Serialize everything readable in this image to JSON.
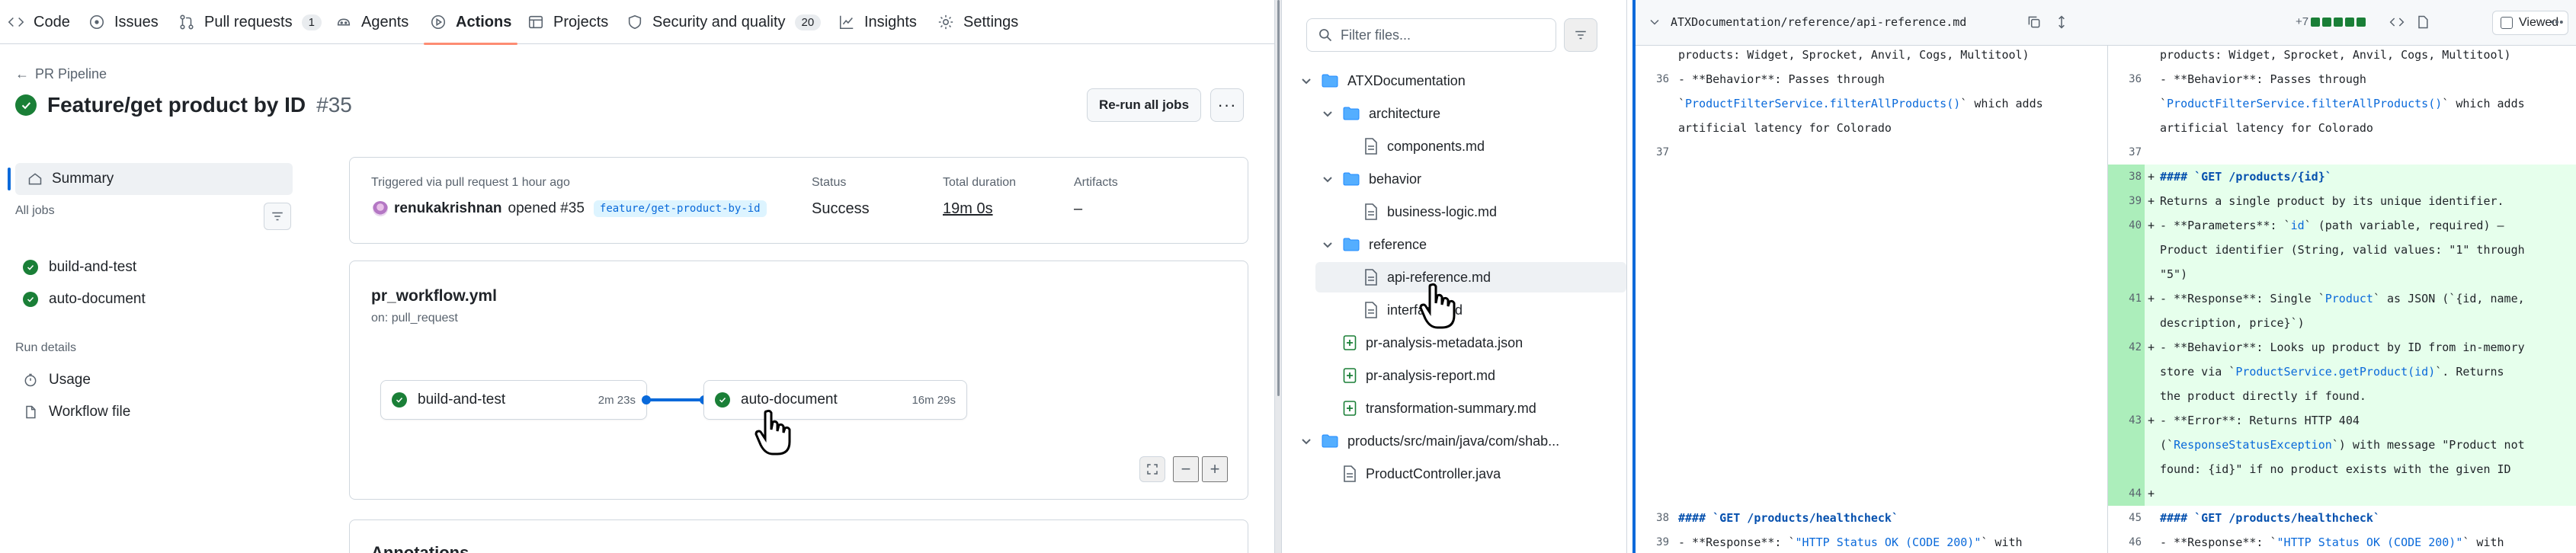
{
  "repo_nav": {
    "items": [
      {
        "label": "Code",
        "icon": "code-icon"
      },
      {
        "label": "Issues",
        "icon": "issue-opened-icon"
      },
      {
        "label": "Pull requests",
        "icon": "git-pull-request-icon",
        "count": "1"
      },
      {
        "label": "Agents",
        "icon": "agent-icon"
      },
      {
        "label": "Actions",
        "icon": "play-icon",
        "active": true
      },
      {
        "label": "Projects",
        "icon": "table-icon"
      },
      {
        "label": "Security and quality",
        "icon": "shield-icon",
        "count": "20"
      },
      {
        "label": "Insights",
        "icon": "graph-icon"
      },
      {
        "label": "Settings",
        "icon": "gear-icon"
      }
    ]
  },
  "run": {
    "back_label": "PR Pipeline",
    "title": "Feature/get product by ID",
    "number": "#35",
    "rerun_label": "Re-run all jobs",
    "more_label": "···"
  },
  "sidebar": {
    "summary_label": "Summary",
    "all_jobs_label": "All jobs",
    "jobs": [
      "build-and-test",
      "auto-document"
    ],
    "run_details_label": "Run details",
    "details": [
      "Usage",
      "Workflow file"
    ]
  },
  "trigger": {
    "triggered_text": "Triggered via pull request 1 hour ago",
    "user": "renukakrishnan",
    "action_text": "opened #35",
    "branch": "feature/get-product-by-id",
    "status_label": "Status",
    "status_value": "Success",
    "duration_label": "Total duration",
    "duration_value": "19m 0s",
    "artifacts_label": "Artifacts",
    "artifacts_value": "–"
  },
  "workflow": {
    "file": "pr_workflow.yml",
    "on": "on: pull_request",
    "jobs": [
      {
        "name": "build-and-test",
        "duration": "2m 23s"
      },
      {
        "name": "auto-document",
        "duration": "16m 29s"
      }
    ],
    "annotations_title": "Annotations"
  },
  "file_tree": {
    "filter_placeholder": "Filter files...",
    "rows": [
      {
        "type": "folder",
        "label": "ATXDocumentation",
        "depth": 0,
        "expanded": true
      },
      {
        "type": "folder",
        "label": "architecture",
        "depth": 1,
        "expanded": true
      },
      {
        "type": "file",
        "label": "components.md",
        "depth": 2
      },
      {
        "type": "folder",
        "label": "behavior",
        "depth": 1,
        "expanded": true
      },
      {
        "type": "file",
        "label": "business-logic.md",
        "depth": 2
      },
      {
        "type": "folder",
        "label": "reference",
        "depth": 1,
        "expanded": true
      },
      {
        "type": "file",
        "label": "api-reference.md",
        "depth": 2,
        "selected": true
      },
      {
        "type": "file",
        "label": "interface.md",
        "depth": 2
      },
      {
        "type": "file-added",
        "label": "pr-analysis-metadata.json",
        "depth": 1
      },
      {
        "type": "file-added",
        "label": "pr-analysis-report.md",
        "depth": 1
      },
      {
        "type": "file-added",
        "label": "transformation-summary.md",
        "depth": 1
      },
      {
        "type": "folder",
        "label": "products/src/main/java/com/shab...",
        "depth": 0,
        "expanded": true
      },
      {
        "type": "file",
        "label": "ProductController.java",
        "depth": 1
      }
    ]
  },
  "diff": {
    "path": "ATXDocumentation/reference/api-reference.md",
    "stat": "+7",
    "viewed_label": "Viewed",
    "top_line": "products: Widget, Sprocket, Anvil, Cogs, Multitool)",
    "ctx_36": {
      "num": "36",
      "lines": [
        "- **Behavior**: Passes through",
        "`ProductFilterService.filterAllProducts()` which adds",
        "artificial latency for Colorado"
      ]
    },
    "ctx_37": {
      "num": "37"
    },
    "added": [
      {
        "num": "38",
        "lines": [
          "#### `GET /products/{id}`"
        ]
      },
      {
        "num": "39",
        "lines": [
          "Returns a single product by its unique identifier."
        ]
      },
      {
        "num": "40",
        "lines": [
          "- **Parameters**: `id` (path variable, required) —",
          "Product identifier (String, valid values: \"1\" through",
          "\"5\")"
        ]
      },
      {
        "num": "41",
        "lines": [
          "- **Response**: Single `Product` as JSON (`{id, name,",
          "description, price}`)"
        ]
      },
      {
        "num": "42",
        "lines": [
          "- **Behavior**: Looks up product by ID from in-memory",
          "store via `ProductService.getProduct(id)`. Returns",
          "the product directly if found."
        ]
      },
      {
        "num": "43",
        "lines": [
          "- **Error**: Returns HTTP 404",
          "(`ResponseStatusException`) with message \"Product not",
          "found: {id}\" if no product exists with the given ID"
        ]
      },
      {
        "num": "44",
        "lines": [
          ""
        ]
      }
    ],
    "after_left": [
      {
        "num": "38",
        "text": "#### `GET /products/healthcheck`"
      },
      {
        "num": "39",
        "text": "- **Response**: `\"HTTP Status OK (CODE 200)\"` with"
      }
    ],
    "after_right": [
      {
        "num": "45",
        "text": "#### `GET /products/healthcheck`"
      },
      {
        "num": "46",
        "text": "- **Response**: `\"HTTP Status OK (CODE 200)\"` with"
      }
    ]
  },
  "colors": {
    "success": "#1a7f37",
    "accent": "#0969da",
    "added_bg": "#e6ffec",
    "active_tab": "#fd8c73"
  }
}
